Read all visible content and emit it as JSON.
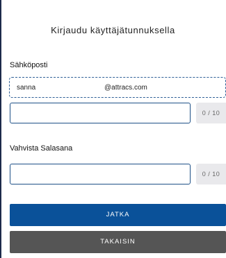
{
  "form": {
    "title": "Kirjaudu käyttäjätunnuksella",
    "email_label": "Sähköposti",
    "email_user": "sanna",
    "email_domain": "@attracs.com",
    "password_counter": "0 / 10",
    "confirm_label": "Vahvista Salasana",
    "confirm_counter": "0 / 10",
    "continue_label": "JATKA",
    "back_label": "TAKAISIN"
  },
  "colors": {
    "primary": "#0a5199",
    "secondary": "#555555",
    "field_border": "#1c4f86"
  }
}
